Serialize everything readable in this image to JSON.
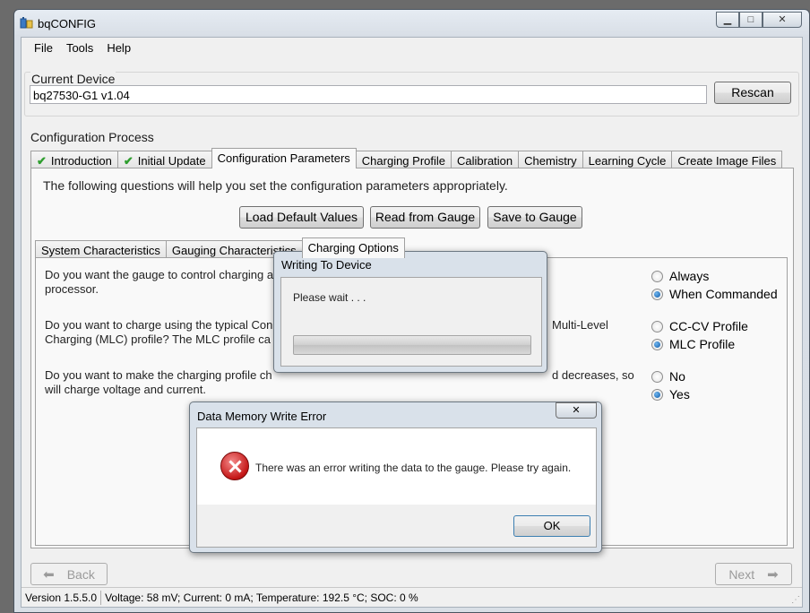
{
  "window": {
    "title": "bqCONFIG",
    "minimize": "▭",
    "maximize": "□",
    "close": "✕"
  },
  "menu": [
    "File",
    "Tools",
    "Help"
  ],
  "current_device": {
    "label": "Current Device",
    "value": "bq27530-G1 v1.04",
    "rescan": "Rescan"
  },
  "config": {
    "label": "Configuration Process",
    "tabs": [
      {
        "label": "Introduction",
        "checked": true
      },
      {
        "label": "Initial Update",
        "checked": true
      },
      {
        "label": "Configuration Parameters",
        "active": true
      },
      {
        "label": "Charging Profile"
      },
      {
        "label": "Calibration"
      },
      {
        "label": "Chemistry"
      },
      {
        "label": "Learning Cycle"
      },
      {
        "label": "Create Image Files"
      }
    ],
    "intro": "The following questions will help you set the configuration parameters appropriately.",
    "buttons": {
      "load": "Load Default Values",
      "read": "Read from Gauge",
      "save": "Save to Gauge"
    },
    "subtabs": [
      "System Characteristics",
      "Gauging Characteristics",
      "Charging Options"
    ],
    "questions": [
      {
        "line1": "Do you want the gauge to control charging a",
        "line1b": "",
        "line2": "processor.",
        "options": [
          "Always",
          "When Commanded"
        ],
        "selected": 1
      },
      {
        "line1": "Do you want to charge using the typical Con",
        "line1b": "Multi-Level",
        "line2": "Charging (MLC) profile? The MLC profile ca",
        "options": [
          "CC-CV Profile",
          "MLC Profile"
        ],
        "selected": 1
      },
      {
        "line1": "Do you want to make the charging profile ch",
        "line1b": "d decreases, so",
        "line2": "will charge voltage and current.",
        "options": [
          "No",
          "Yes"
        ],
        "selected": 1
      }
    ]
  },
  "nav": {
    "back": "Back",
    "next": "Next"
  },
  "status": {
    "version": "Version 1.5.5.0",
    "readings": "Voltage: 58 mV; Current: 0 mA; Temperature: 192.5 °C; SOC: 0 %"
  },
  "writing_dialog": {
    "title": "Writing To Device",
    "message": "Please wait . . ."
  },
  "error_dialog": {
    "title": "Data Memory Write Error",
    "message": "There was an error writing the data to the gauge. Please try again.",
    "ok": "OK",
    "close": "✕"
  }
}
